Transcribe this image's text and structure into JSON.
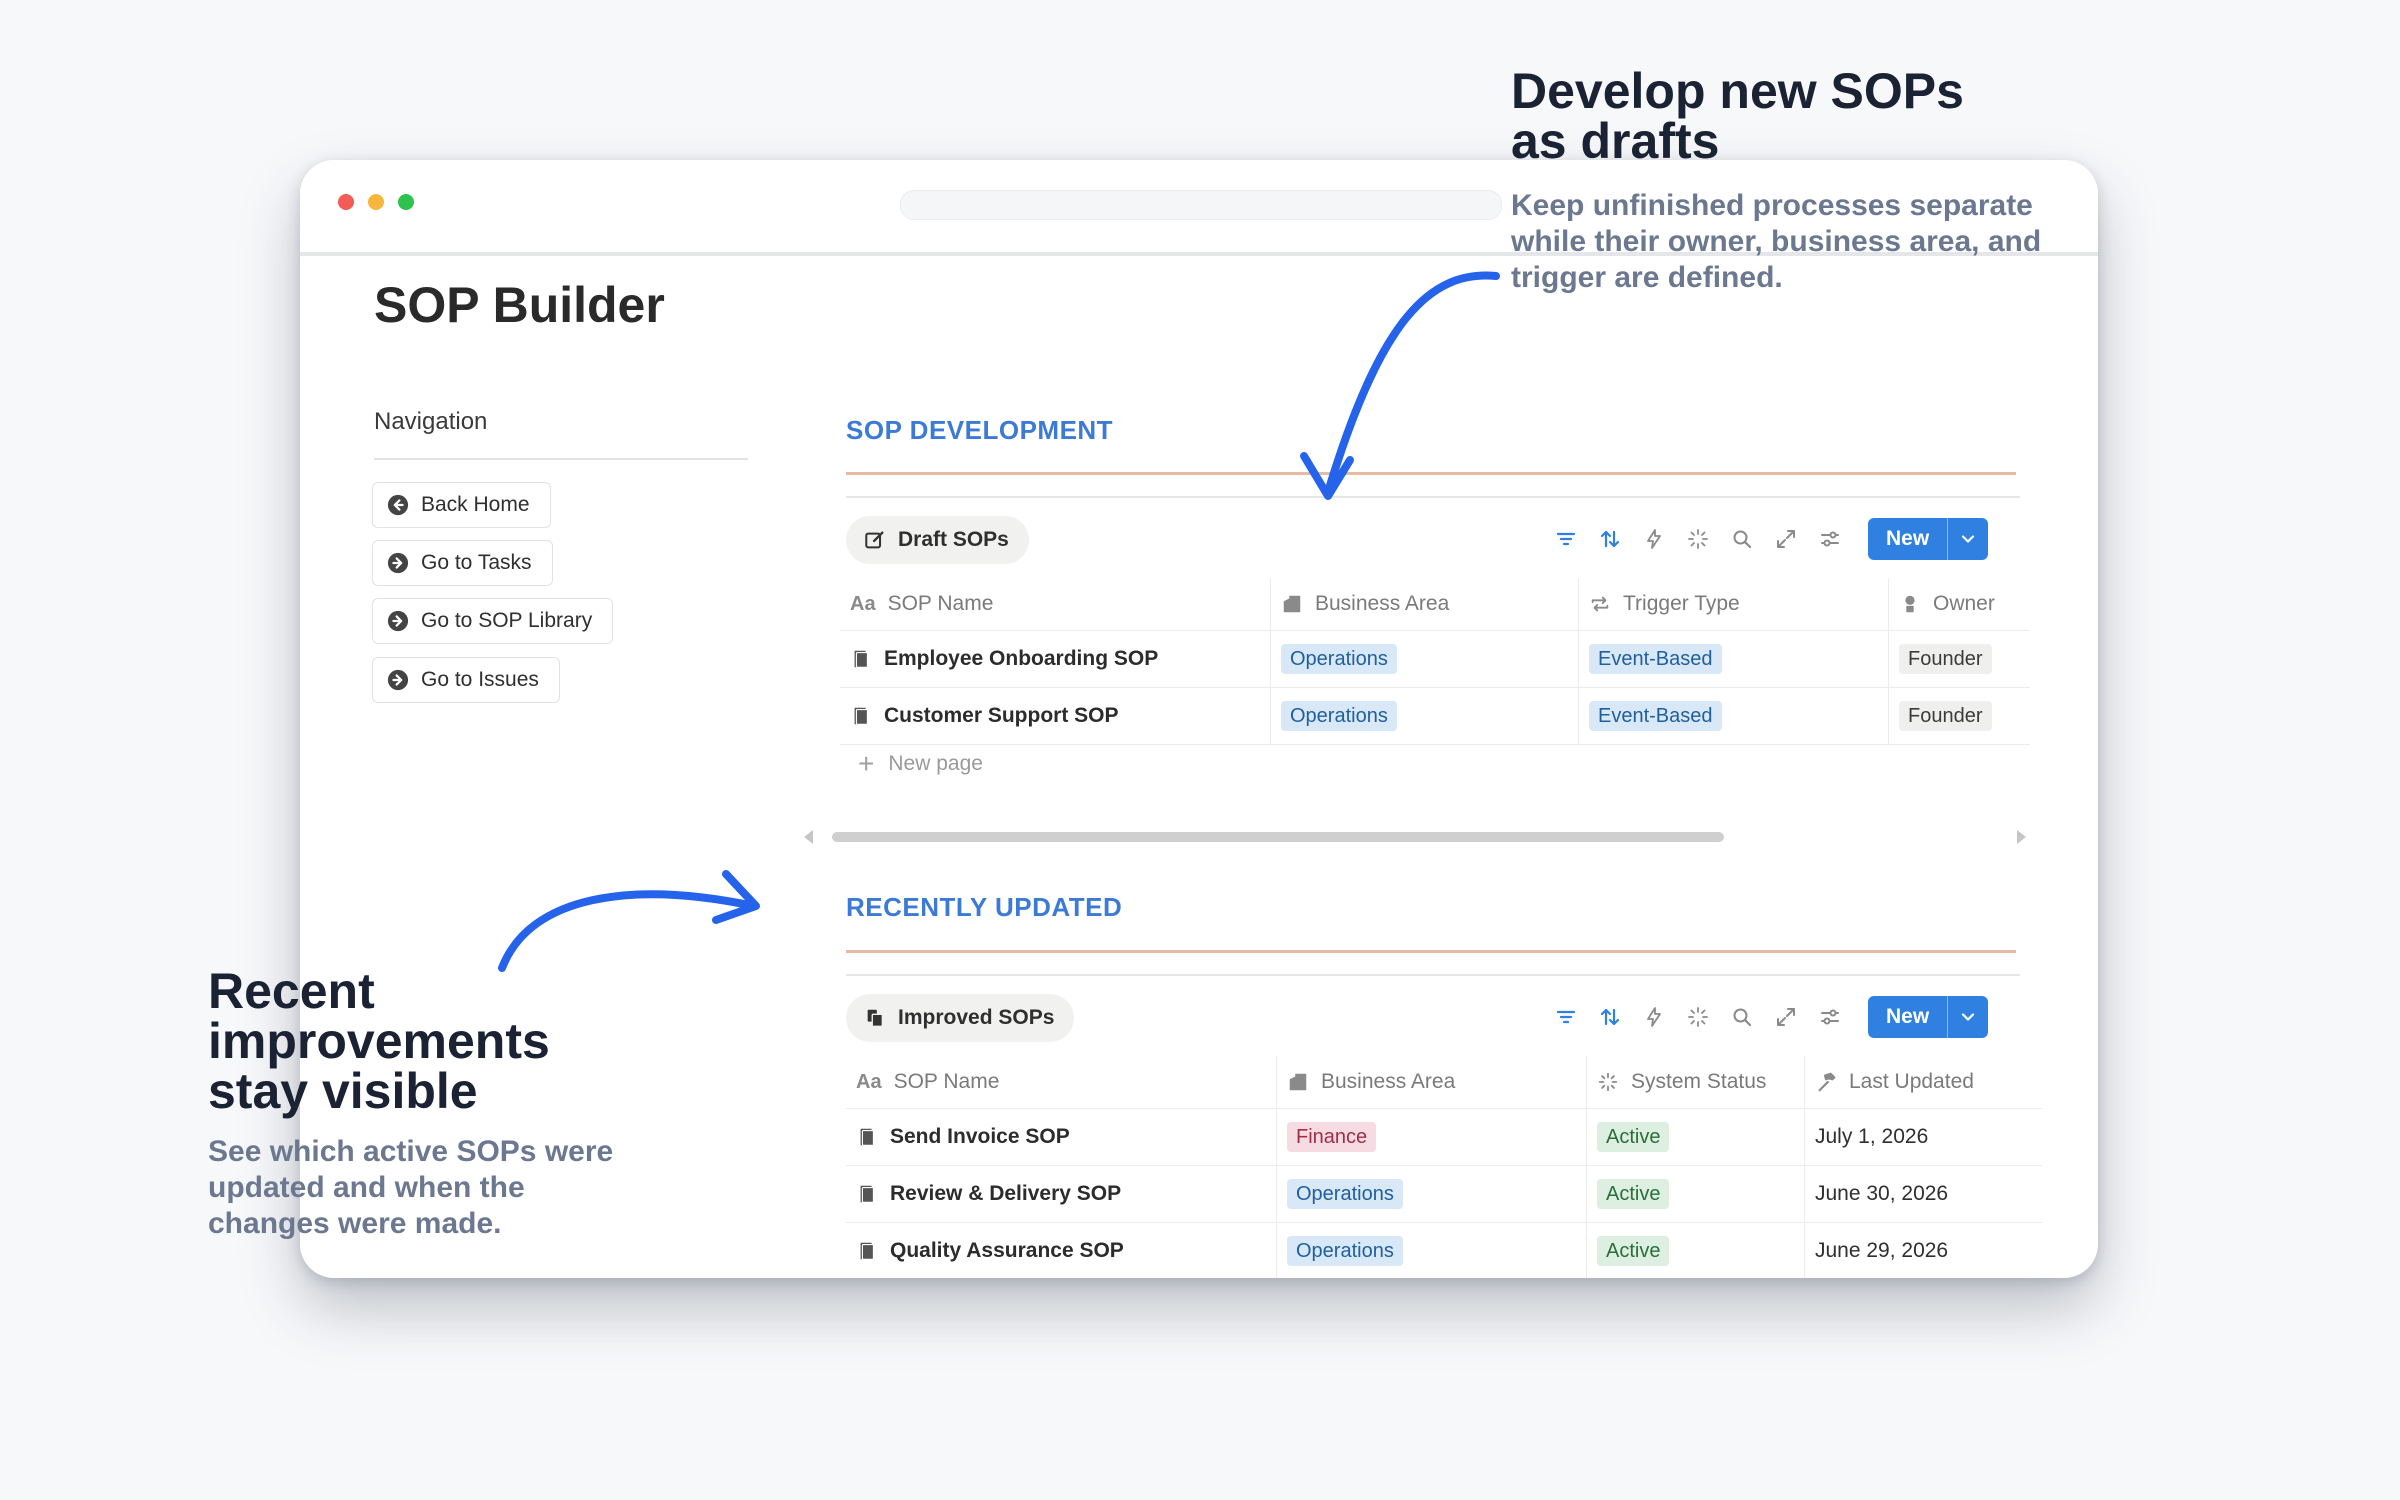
{
  "app": {
    "title": "SOP Builder"
  },
  "navigation": {
    "heading": "Navigation",
    "items": [
      {
        "label": "Back Home",
        "icon": "arrow-left-circle-icon"
      },
      {
        "label": "Go to Tasks",
        "icon": "arrow-right-circle-icon"
      },
      {
        "label": "Go to SOP Library",
        "icon": "arrow-right-circle-icon"
      },
      {
        "label": "Go to Issues",
        "icon": "arrow-right-circle-icon"
      }
    ]
  },
  "development": {
    "section_title": "SOP DEVELOPMENT",
    "view_tab": "Draft SOPs",
    "new_button": "New",
    "columns": [
      "SOP Name",
      "Business Area",
      "Trigger Type",
      "Owner"
    ],
    "rows": [
      {
        "name": "Employee Onboarding SOP",
        "area": "Operations",
        "trigger": "Event-Based",
        "owner": "Founder"
      },
      {
        "name": "Customer Support SOP",
        "area": "Operations",
        "trigger": "Event-Based",
        "owner": "Founder"
      }
    ],
    "new_page": "New page"
  },
  "recent": {
    "section_title": "RECENTLY UPDATED",
    "view_tab": "Improved SOPs",
    "new_button": "New",
    "columns": [
      "SOP Name",
      "Business Area",
      "System Status",
      "Last Updated"
    ],
    "rows": [
      {
        "name": "Send Invoice SOP",
        "area": "Finance",
        "status": "Active",
        "updated": "July 1, 2026"
      },
      {
        "name": "Review & Delivery SOP",
        "area": "Operations",
        "status": "Active",
        "updated": "June 30, 2026"
      },
      {
        "name": "Quality Assurance SOP",
        "area": "Operations",
        "status": "Active",
        "updated": "June 29, 2026"
      }
    ]
  },
  "callouts": {
    "top": {
      "title_line1": "Develop new SOPs",
      "title_line2": "as drafts",
      "text_line1": "Keep unfinished processes separate",
      "text_line2": "while their owner, business area, and",
      "text_line3": "trigger are defined."
    },
    "bottom": {
      "title_line1": "Recent",
      "title_line2": "improvements",
      "title_line3": "stay visible",
      "text_line1": "See which active SOPs were",
      "text_line2": "updated and when the",
      "text_line3": "changes were made."
    }
  },
  "colors": {
    "accent_blue": "#2f80e0",
    "section_title": "#3b7ad6",
    "arrow": "#2563eb",
    "tag_blue": "#d9e8f7",
    "tag_pink": "#f7dbe2",
    "tag_green": "#dcefe0",
    "tag_gray": "#efefed"
  }
}
